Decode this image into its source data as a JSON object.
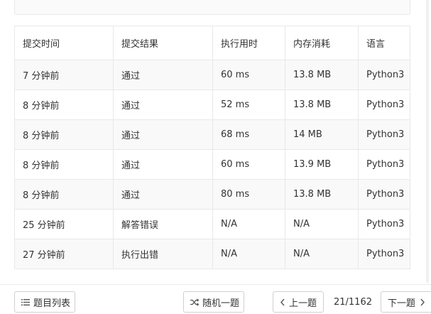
{
  "table": {
    "headers": [
      "提交时间",
      "提交结果",
      "执行用时",
      "内存消耗",
      "语言"
    ],
    "rows": [
      {
        "time": "7 分钟前",
        "result": "通过",
        "runtime": "60 ms",
        "memory": "13.8 MB",
        "language": "Python3",
        "status": "pass"
      },
      {
        "time": "8 分钟前",
        "result": "通过",
        "runtime": "52 ms",
        "memory": "13.8 MB",
        "language": "Python3",
        "status": "pass"
      },
      {
        "time": "8 分钟前",
        "result": "通过",
        "runtime": "68 ms",
        "memory": "14 MB",
        "language": "Python3",
        "status": "pass"
      },
      {
        "time": "8 分钟前",
        "result": "通过",
        "runtime": "60 ms",
        "memory": "13.9 MB",
        "language": "Python3",
        "status": "pass"
      },
      {
        "time": "8 分钟前",
        "result": "通过",
        "runtime": "80 ms",
        "memory": "13.8 MB",
        "language": "Python3",
        "status": "pass"
      },
      {
        "time": "25 分钟前",
        "result": "解答错误",
        "runtime": "N/A",
        "memory": "N/A",
        "language": "Python3",
        "status": "fail"
      },
      {
        "time": "27 分钟前",
        "result": "执行出错",
        "runtime": "N/A",
        "memory": "N/A",
        "language": "Python3",
        "status": "fail"
      }
    ]
  },
  "footer": {
    "problem_list_label": "题目列表",
    "random_label": "随机一题",
    "prev_label": "上一题",
    "page_indicator": "21/1162",
    "next_label": "下一题"
  },
  "colors": {
    "pass": "#1a9aa0",
    "fail": "#cc2a2a",
    "row_stripe": "#f9f9f9",
    "border": "#e8e8e8"
  },
  "icons": {
    "problem_list": "list-icon",
    "random": "shuffle-icon",
    "prev": "chevron-left-icon",
    "next": "chevron-right-icon"
  }
}
